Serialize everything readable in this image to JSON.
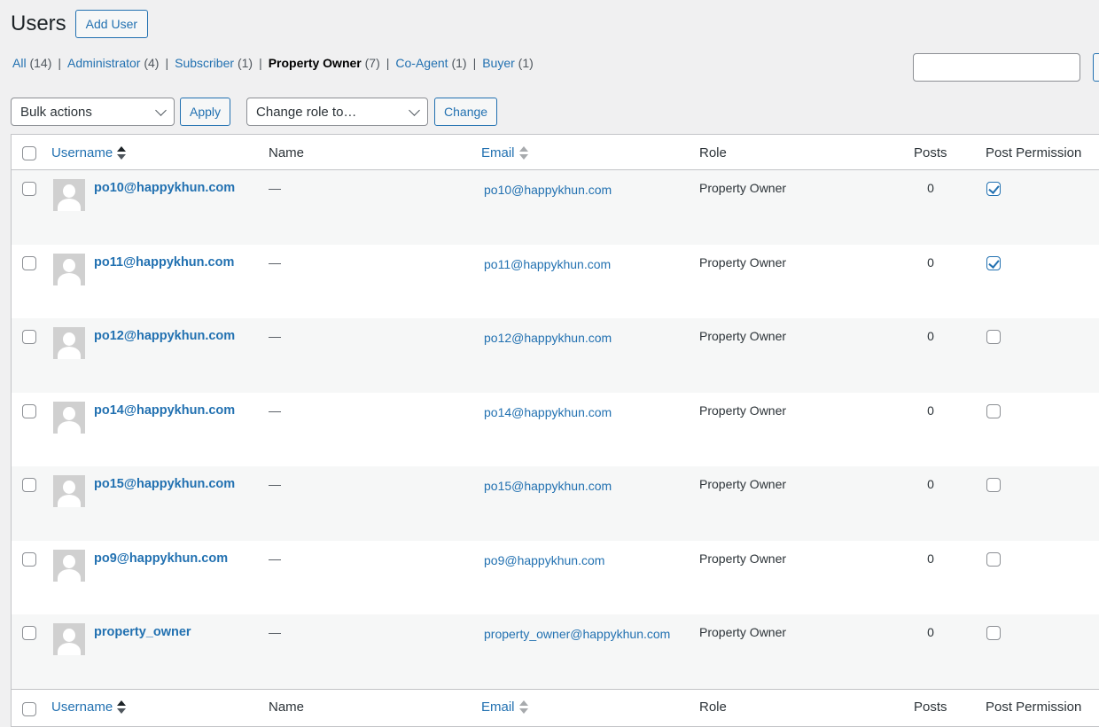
{
  "page": {
    "title": "Users",
    "add_user_label": "Add User"
  },
  "filters": [
    {
      "label": "All",
      "count": "(14)",
      "current": false
    },
    {
      "label": "Administrator",
      "count": "(4)",
      "current": false
    },
    {
      "label": "Subscriber",
      "count": "(1)",
      "current": false
    },
    {
      "label": "Property Owner",
      "count": "(7)",
      "current": true
    },
    {
      "label": "Co-Agent",
      "count": "(1)",
      "current": false
    },
    {
      "label": "Buyer",
      "count": "(1)",
      "current": false
    }
  ],
  "filter_separator": "|",
  "search": {
    "value": ""
  },
  "toolbar": {
    "bulk_actions_selected": "Bulk actions",
    "apply_label": "Apply",
    "change_role_selected": "Change role to…",
    "change_label": "Change"
  },
  "columns": {
    "username": "Username",
    "name": "Name",
    "email": "Email",
    "role": "Role",
    "posts": "Posts",
    "post_permission": "Post Permission"
  },
  "users": [
    {
      "username": "po10@happykhun.com",
      "name": "—",
      "email": "po10@happykhun.com",
      "role": "Property Owner",
      "posts": "0",
      "post_permission": true
    },
    {
      "username": "po11@happykhun.com",
      "name": "—",
      "email": "po11@happykhun.com",
      "role": "Property Owner",
      "posts": "0",
      "post_permission": true
    },
    {
      "username": "po12@happykhun.com",
      "name": "—",
      "email": "po12@happykhun.com",
      "role": "Property Owner",
      "posts": "0",
      "post_permission": false
    },
    {
      "username": "po14@happykhun.com",
      "name": "—",
      "email": "po14@happykhun.com",
      "role": "Property Owner",
      "posts": "0",
      "post_permission": false
    },
    {
      "username": "po15@happykhun.com",
      "name": "—",
      "email": "po15@happykhun.com",
      "role": "Property Owner",
      "posts": "0",
      "post_permission": false
    },
    {
      "username": "po9@happykhun.com",
      "name": "—",
      "email": "po9@happykhun.com",
      "role": "Property Owner",
      "posts": "0",
      "post_permission": false
    },
    {
      "username": "property_owner",
      "name": "—",
      "email": "property_owner@happykhun.com",
      "role": "Property Owner",
      "posts": "0",
      "post_permission": false
    }
  ],
  "colors": {
    "link": "#2271b1",
    "background": "#f0f0f1",
    "alt_row": "#f6f7f7",
    "border": "#c3c4c7"
  }
}
